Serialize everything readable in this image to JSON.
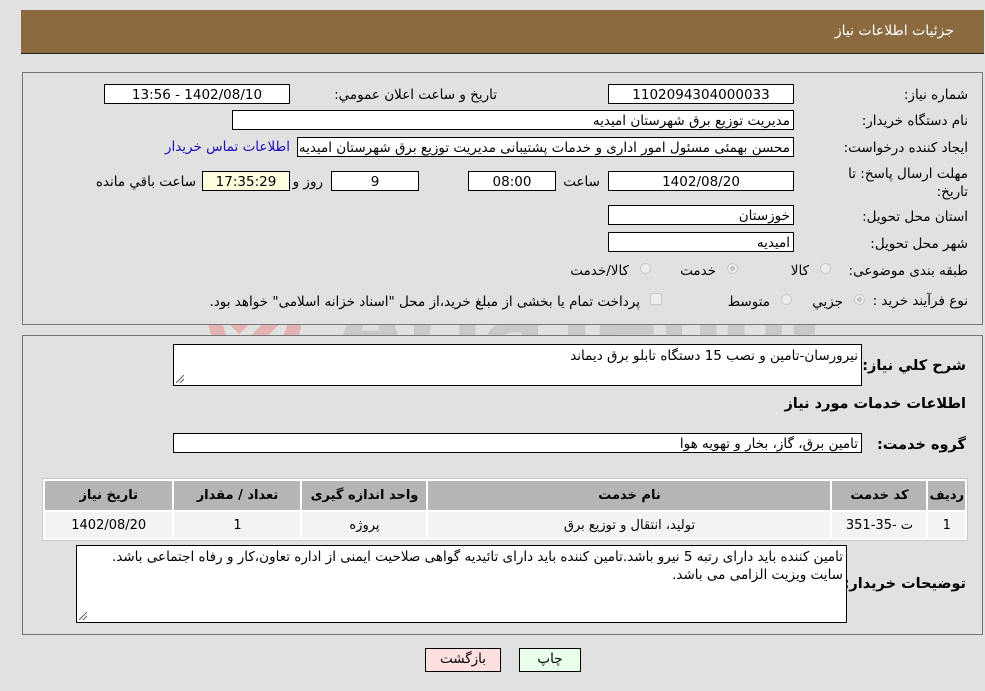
{
  "header": {
    "title": "جزئیات اطلاعات نیاز"
  },
  "need_info": {
    "need_number_label": "شماره نیاز:",
    "need_number": "1102094304000033",
    "announce_label": "تاریخ و ساعت اعلان عمومي:",
    "announce_value": "1402/08/10 - 13:56",
    "buyer_org_label": "نام دستگاه خريدار:",
    "buyer_org": "مدیریت توزیع برق شهرستان امیدیه",
    "creator_label": "ایجاد کننده درخواست:",
    "creator": "محسن بهمئی مسئول امور اداری و خدمات پشتیبانی مدیریت توزیع برق شهرستان امیدیه",
    "contact_link": "اطلاعات تماس خريدار",
    "deadline_label": "مهلت ارسال پاسخ: تا تاریخ:",
    "deadline_date": "1402/08/20",
    "time_label": "ساعت",
    "deadline_time": "08:00",
    "days": "9",
    "days_label": "روز و",
    "remaining_time": "17:35:29",
    "remaining_label": "ساعت باقي مانده",
    "province_label": "استان محل تحویل:",
    "province": "خوزستان",
    "city_label": "شهر محل تحویل:",
    "city": "امیدیه",
    "category_label": "طبقه بندی موضوعی:",
    "category_options": [
      {
        "label": "کالا",
        "checked": false
      },
      {
        "label": "خدمت",
        "checked": true
      },
      {
        "label": "کالا/خدمت",
        "checked": false
      }
    ],
    "process_label": "نوع فرآیند خرید :",
    "process_options": [
      {
        "label": "جزيي",
        "checked": true
      },
      {
        "label": "متوسط",
        "checked": false
      }
    ],
    "treasury_note": "پرداخت تمام یا بخشی از مبلغ خرید،از محل \"اسناد خزانه اسلامی\" خواهد بود.",
    "treasury_checked": false
  },
  "description": {
    "label": "شرح کلي نياز:",
    "value": "نیرورسان-تامین و نصب 15 دستگاه تابلو برق دیماند"
  },
  "services": {
    "section_title": "اطلاعات خدمات مورد نياز",
    "group_label": "گروه خدمت:",
    "group_value": "تامین برق، گاز، بخار و تهویه هوا",
    "columns": [
      "رديف",
      "کد خدمت",
      "نام خدمت",
      "واحد اندازه گيری",
      "تعداد / مقدار",
      "تاریخ نیاز"
    ],
    "rows": [
      [
        "1",
        "ت -35-351",
        "تولید، انتقال و توزیع برق",
        "پروژه",
        "1",
        "1402/08/20"
      ]
    ]
  },
  "buyer_notes": {
    "label": "توضيحات خريدار:",
    "value": "تامین کننده باید دارای رتبه 5 نیرو باشد.تامین کننده باید دارای تائیدیه گواهی صلاحیت ایمنی از اداره تعاون،کار و رفاه اجتماعی باشد. سایت ویزیت الزامی می باشد."
  },
  "buttons": {
    "print": "چاپ",
    "back": "بازگشت"
  },
  "watermark": {
    "text": "AriaTender.neT"
  },
  "colors": {
    "header_bg": "#8b6a40",
    "print_bg": "#eaffea",
    "back_bg": "#ffe0e0",
    "link": "#1a0dbd"
  }
}
